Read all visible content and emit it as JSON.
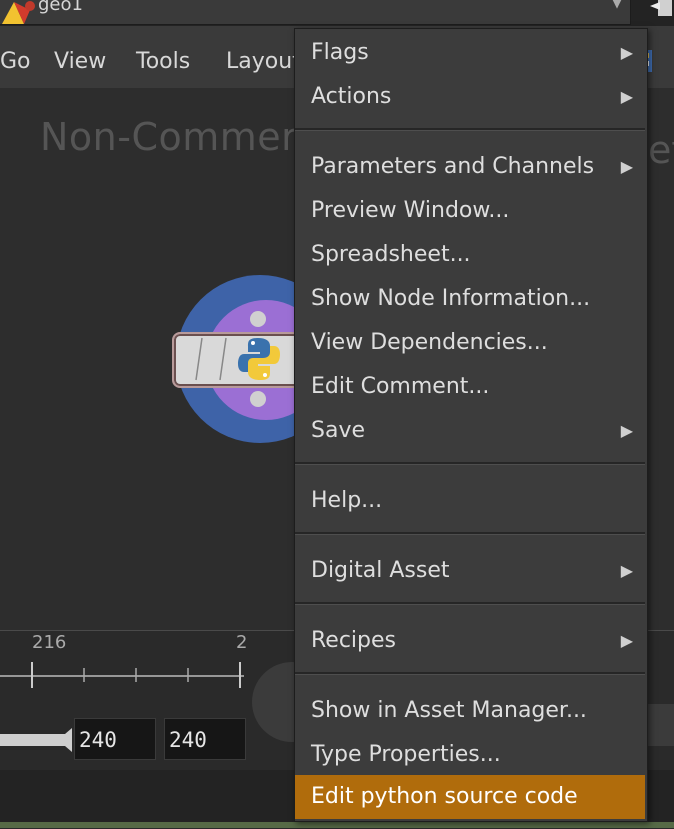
{
  "pathbar": {
    "path": "geo1",
    "dropdown_icon": "chevron-down-icon"
  },
  "menubar": {
    "go": "Go",
    "view": "View",
    "tools": "Tools",
    "layout": "Layout"
  },
  "canvas": {
    "watermark": "Non-Commerc",
    "watermark_tail": "et"
  },
  "timeline": {
    "tick_a": "216",
    "tick_b": "2",
    "frame_start": "240",
    "frame_end": "240"
  },
  "context_menu": {
    "flags": "Flags",
    "actions": "Actions",
    "parameters_channels": "Parameters and Channels",
    "preview_window": "Preview Window...",
    "spreadsheet": "Spreadsheet...",
    "show_node_info": "Show Node Information...",
    "view_dependencies": "View Dependencies...",
    "edit_comment": "Edit Comment...",
    "save": "Save",
    "help": "Help...",
    "digital_asset": "Digital Asset",
    "recipes": "Recipes",
    "show_in_asset_manager": "Show in Asset Manager...",
    "type_properties": "Type Properties...",
    "edit_python_source": "Edit python source code"
  },
  "colors": {
    "highlight": "#b06c0c",
    "node_outer": "#3e63a8",
    "node_inner": "#9b6fd4"
  }
}
